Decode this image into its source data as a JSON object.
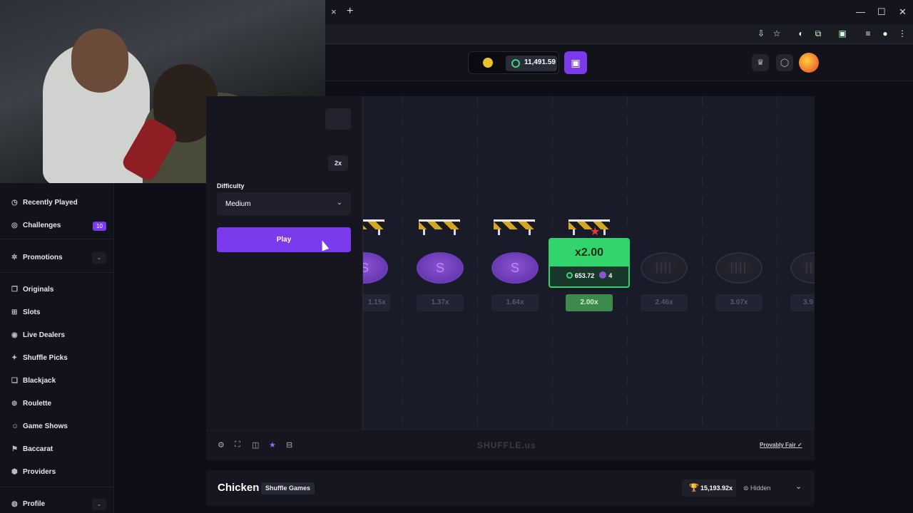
{
  "browser": {
    "tab_close": "×",
    "tab_new": "+",
    "window_minimize": "—",
    "window_maximize": "☐",
    "window_close": "✕"
  },
  "header": {
    "balance": "11,491.59",
    "wallet_icon": "wallet-icon"
  },
  "sidebar": {
    "items": [
      {
        "label": "Recently Played",
        "icon": "clock-icon"
      },
      {
        "label": "Challenges",
        "icon": "target-icon",
        "badge": "10"
      },
      {
        "label": "Promotions",
        "icon": "gear-icon"
      },
      {
        "label": "Originals",
        "icon": "originals-icon"
      },
      {
        "label": "Slots",
        "icon": "slots-icon"
      },
      {
        "label": "Live Dealers",
        "icon": "live-icon"
      },
      {
        "label": "Shuffle Picks",
        "icon": "picks-icon"
      },
      {
        "label": "Blackjack",
        "icon": "cards-icon"
      },
      {
        "label": "Roulette",
        "icon": "roulette-icon"
      },
      {
        "label": "Game Shows",
        "icon": "person-icon"
      },
      {
        "label": "Baccarat",
        "icon": "baccarat-icon"
      },
      {
        "label": "Providers",
        "icon": "providers-icon"
      },
      {
        "label": "Profile",
        "icon": "profile-icon"
      }
    ]
  },
  "controls": {
    "double_label": "2x",
    "difficulty_label": "Difficulty",
    "difficulty_value": "Medium",
    "play_label": "Play"
  },
  "game": {
    "multipliers": [
      "1.15x",
      "1.37x",
      "1.64x",
      "2.00x",
      "2.46x",
      "3.07x",
      "3.9"
    ],
    "current_multiplier": "x2.00",
    "cashout_amount": "653.72",
    "step": "4",
    "coin_glyph": "S",
    "dark_glyph": "||||"
  },
  "toolbar": {
    "brand": "SHUFFLE.us",
    "provably_fair": "Provably Fair ✓"
  },
  "info": {
    "title": "Chicken",
    "provider": "Shuffle Games",
    "max_win": "15,193.92x",
    "visibility": "Hidden"
  },
  "colors": {
    "accent": "#7c3aed",
    "success": "#32d56c",
    "background": "#0e0f16"
  }
}
